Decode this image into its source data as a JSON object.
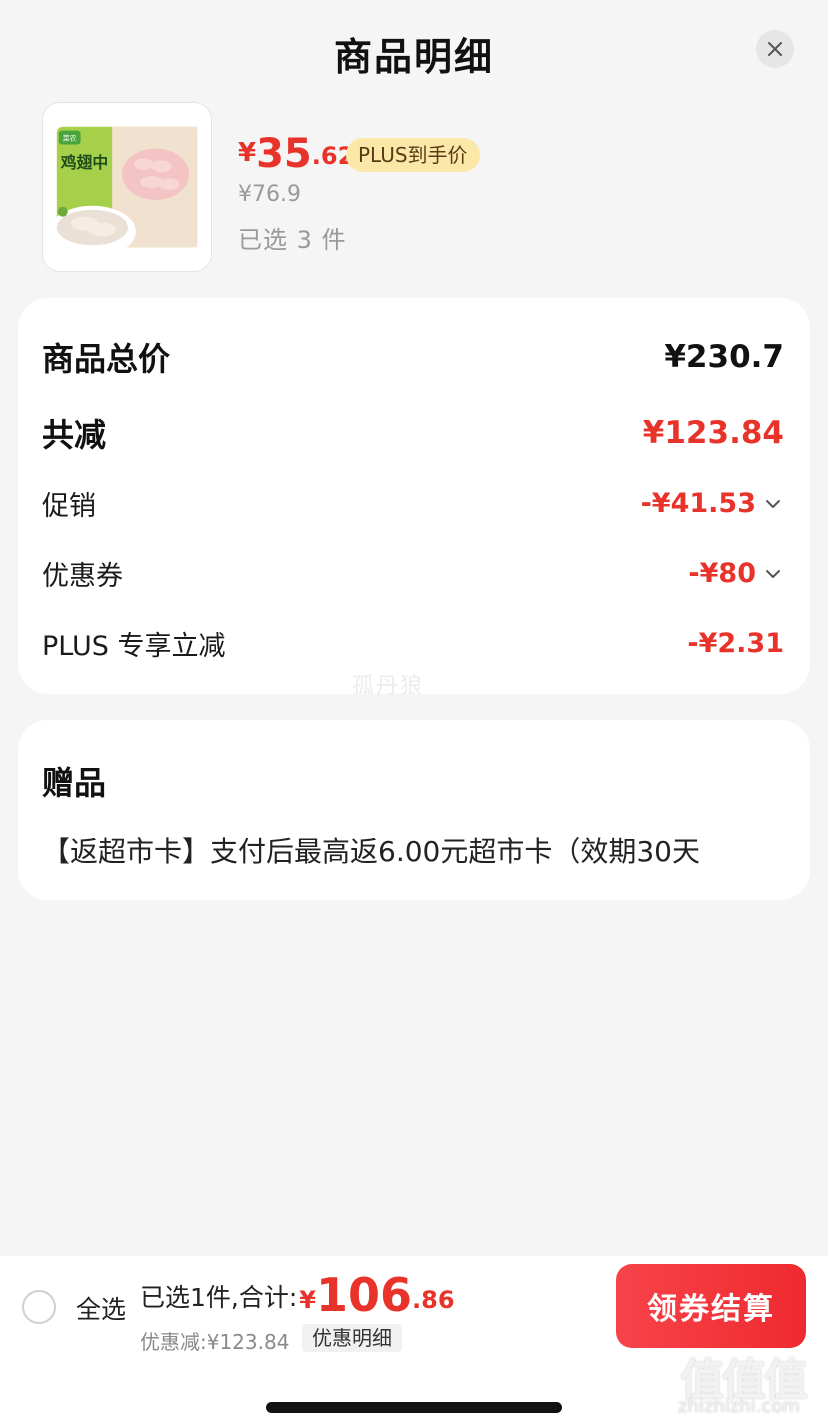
{
  "header": {
    "title": "商品明细",
    "close_icon": "close-icon"
  },
  "product": {
    "image_icon": "chicken-wing-product-image",
    "package_brand": "菜农",
    "package_name": "鸡翅中",
    "price_currency": "¥",
    "price_integer": "35",
    "price_decimal": ".62",
    "plus_badge": "PLUS到手价",
    "original_price": "¥76.9",
    "selected_count": "已选 3 件"
  },
  "summary": {
    "total_label": "商品总价",
    "total_value": "¥230.7",
    "reduction_label": "共减",
    "reduction_value": "¥123.84",
    "items": [
      {
        "label": "促销",
        "value": "-¥41.53",
        "expandable": true
      },
      {
        "label": "优惠券",
        "value": "-¥80",
        "expandable": true
      },
      {
        "label": "PLUS 专享立减",
        "value": "-¥2.31",
        "expandable": false
      }
    ],
    "watermark": "孤丹狼"
  },
  "gift": {
    "title": "赠品",
    "text": "【返超市卡】支付后最高返6.00元超市卡（效期30天"
  },
  "bottom_bar": {
    "select_all": "全选",
    "total_label": "已选1件,合计:",
    "total_currency": "¥",
    "total_integer": "106",
    "total_decimal": ".86",
    "discount_text": "优惠减:¥123.84",
    "detail_link": "优惠明细",
    "checkout_button": "领券结算"
  },
  "site_watermark": {
    "mark": "值值值",
    "url": "zhizhizhi.com"
  },
  "colors": {
    "accent_red": "#e8332a",
    "badge_gold": "#fbe7a8",
    "checkout_red": "#f7434a"
  }
}
